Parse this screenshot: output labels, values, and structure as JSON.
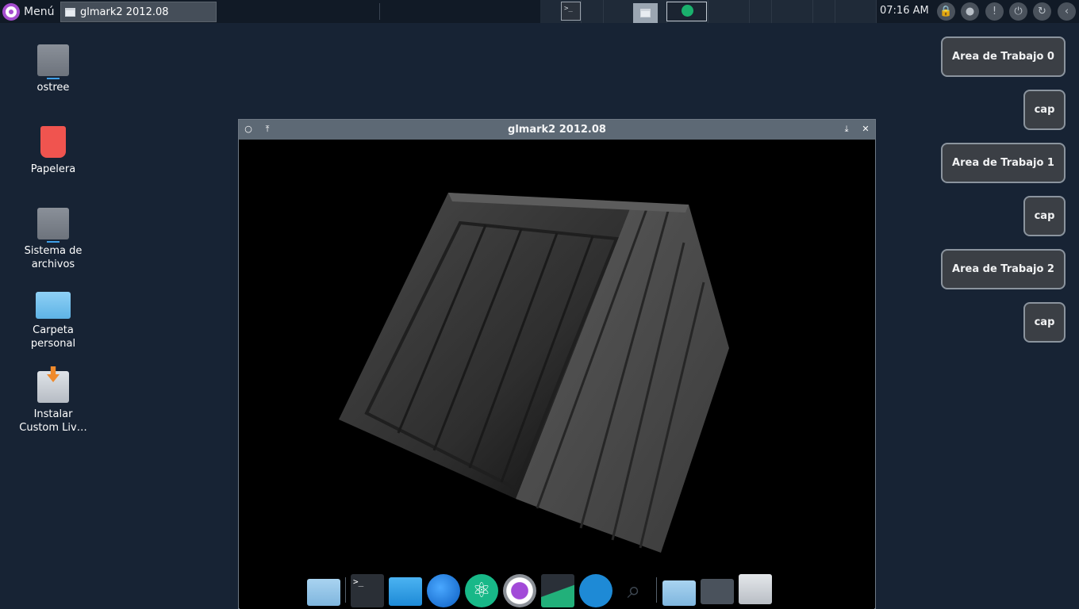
{
  "panel": {
    "menu_label": "Menú",
    "task_label": "glmark2 2012.08",
    "clock": "07:16 AM",
    "action_icons": [
      "lock-icon",
      "user-icon",
      "info-icon",
      "power-icon",
      "restart-icon",
      "back-icon"
    ]
  },
  "desktop_icons": [
    {
      "label": "ostree",
      "icon": "drive-icon"
    },
    {
      "label": "Papelera",
      "icon": "trash-icon"
    },
    {
      "label": "Sistema de archivos",
      "icon": "drive-icon"
    },
    {
      "label": "Carpeta personal",
      "icon": "home-folder-icon"
    },
    {
      "label": "Instalar Custom Liv…",
      "icon": "installer-icon"
    }
  ],
  "workspaces": [
    {
      "label": "Area de Trabajo 0",
      "cap": "cap"
    },
    {
      "label": "Area de Trabajo 1",
      "cap": "cap"
    },
    {
      "label": "Area de Trabajo 2",
      "cap": "cap"
    }
  ],
  "window": {
    "title": "glmark2 2012.08"
  },
  "dock": {
    "items": [
      "drive-folder-icon",
      "terminal-icon",
      "files-icon",
      "browser-icon",
      "atom-icon",
      "camera-icon",
      "system-monitor-icon",
      "app-grid-icon",
      "search-icon",
      "folder-icon",
      "window-icon",
      "usb-drive-icon"
    ]
  },
  "colors": {
    "desktop_bg": "#172334",
    "panel_bg": "#111a26",
    "titlebar_bg": "#5d6975",
    "workspace_bg": "#3b3f45"
  }
}
